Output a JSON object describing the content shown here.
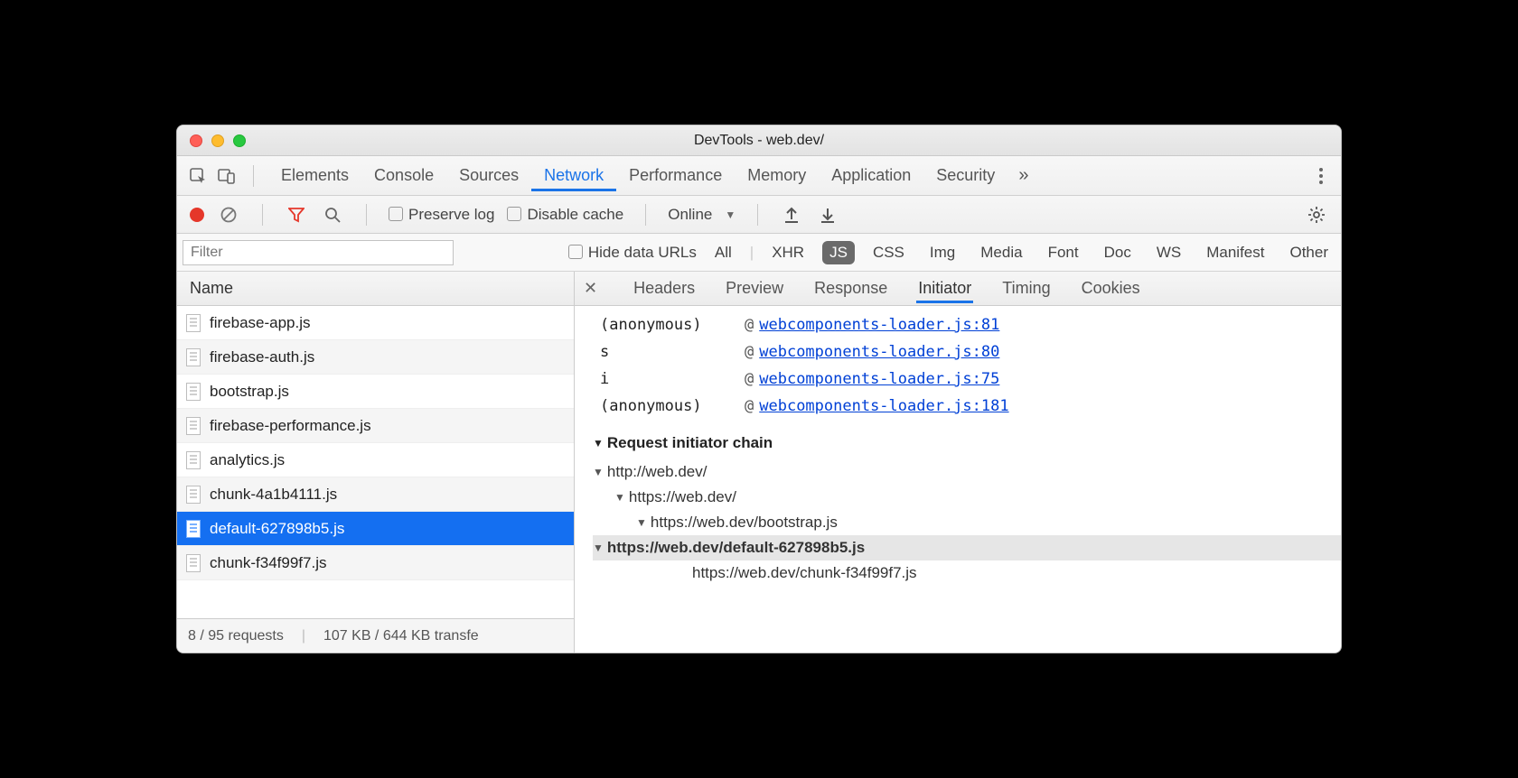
{
  "title": "DevTools - web.dev/",
  "tabs": [
    "Elements",
    "Console",
    "Sources",
    "Network",
    "Performance",
    "Memory",
    "Application",
    "Security"
  ],
  "activeTab": "Network",
  "toolbar": {
    "preserve": "Preserve log",
    "disable": "Disable cache",
    "online": "Online"
  },
  "filter": {
    "placeholder": "Filter",
    "hide": "Hide data URLs",
    "types": [
      "All",
      "XHR",
      "JS",
      "CSS",
      "Img",
      "Media",
      "Font",
      "Doc",
      "WS",
      "Manifest",
      "Other"
    ],
    "activeType": "JS"
  },
  "listHeader": "Name",
  "files": [
    "firebase-app.js",
    "firebase-auth.js",
    "bootstrap.js",
    "firebase-performance.js",
    "analytics.js",
    "chunk-4a1b4111.js",
    "default-627898b5.js",
    "chunk-f34f99f7.js"
  ],
  "selectedFile": "default-627898b5.js",
  "status": {
    "requests": "8 / 95 requests",
    "transfer": "107 KB / 644 KB transfe"
  },
  "detailTabs": [
    "Headers",
    "Preview",
    "Response",
    "Initiator",
    "Timing",
    "Cookies"
  ],
  "activeDetail": "Initiator",
  "stack": [
    {
      "fn": "(anonymous)",
      "link": "webcomponents-loader.js:81"
    },
    {
      "fn": "s",
      "link": "webcomponents-loader.js:80"
    },
    {
      "fn": "i",
      "link": "webcomponents-loader.js:75"
    },
    {
      "fn": "(anonymous)",
      "link": "webcomponents-loader.js:181"
    }
  ],
  "chainHeader": "Request initiator chain",
  "chain": [
    {
      "indent": 0,
      "label": "http://web.dev/",
      "bold": false,
      "arrow": true
    },
    {
      "indent": 1,
      "label": "https://web.dev/",
      "bold": false,
      "arrow": true
    },
    {
      "indent": 2,
      "label": "https://web.dev/bootstrap.js",
      "bold": false,
      "arrow": true
    },
    {
      "indent": 3,
      "label": "https://web.dev/default-627898b5.js",
      "bold": true,
      "arrow": true
    },
    {
      "indent": 4,
      "label": "https://web.dev/chunk-f34f99f7.js",
      "bold": false,
      "arrow": false
    }
  ]
}
